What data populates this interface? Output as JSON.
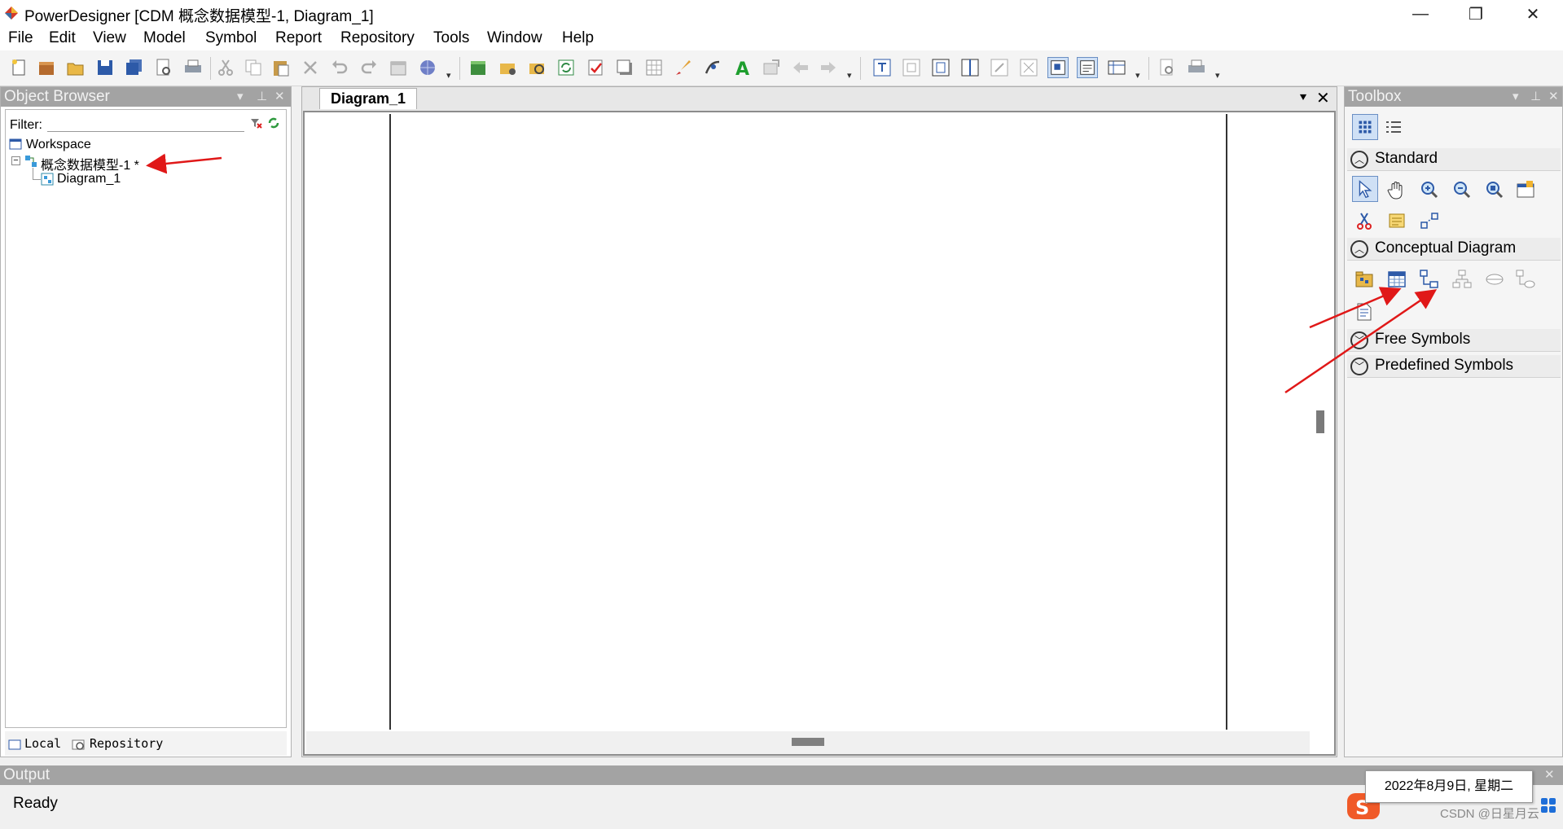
{
  "window": {
    "title": "PowerDesigner [CDM 概念数据模型-1, Diagram_1]",
    "minimize_glyph": "—",
    "restore_glyph": "❐",
    "close_glyph": "✕"
  },
  "menu": [
    "File",
    "Edit",
    "View",
    "Model",
    "Symbol",
    "Report",
    "Repository",
    "Tools",
    "Window",
    "Help"
  ],
  "object_browser": {
    "title": "Object Browser",
    "filter_label": "Filter:",
    "filter_value": "",
    "tree": {
      "workspace": "Workspace",
      "model": "概念数据模型-1 *",
      "diagram": "Diagram_1"
    },
    "tabs": {
      "local": "Local",
      "repository": "Repository"
    }
  },
  "document": {
    "tab_label": "Diagram_1"
  },
  "toolbox": {
    "title": "Toolbox",
    "sections": {
      "standard": "Standard",
      "conceptual": "Conceptual Diagram",
      "free": "Free Symbols",
      "predefined": "Predefined Symbols"
    }
  },
  "output": {
    "title": "Output",
    "status": "Ready"
  },
  "tray": {
    "tooltip": "2022年8月9日, 星期二",
    "watermark": "CSDN @日星月云"
  },
  "colors": {
    "panel_header": "#a3a3a3",
    "annotation_arrow": "#e01818",
    "accent_blue": "#3a6ea5"
  }
}
